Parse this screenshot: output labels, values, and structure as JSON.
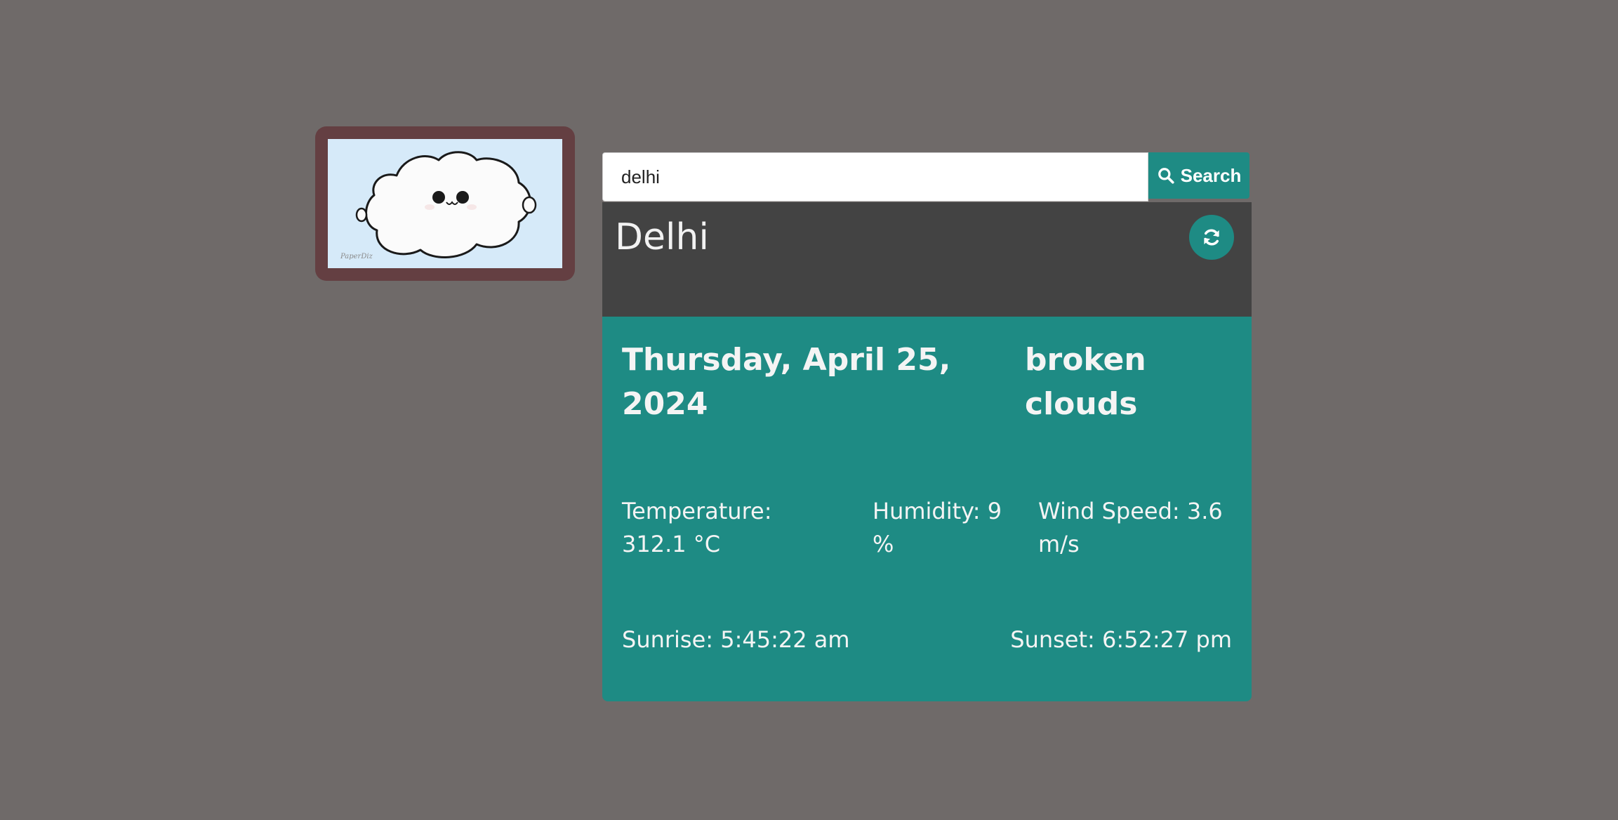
{
  "search": {
    "value": "delhi",
    "button_label": "Search"
  },
  "weather": {
    "city": "Delhi",
    "date": "Thursday, April 25, 2024",
    "description": "broken clouds",
    "temperature": {
      "label": "Temperature:",
      "value": "312.1 °C"
    },
    "humidity": {
      "label": "Humidity:",
      "value": "9 %"
    },
    "wind_speed": {
      "label": "Wind Speed:",
      "value": "3.6 m/s"
    },
    "sunrise": {
      "label": "Sunrise:",
      "value": "5:45:22 am"
    },
    "sunset": {
      "label": "Sunset:",
      "value": "6:52:27 pm"
    }
  },
  "illustration": {
    "signature": "PaperDiz"
  },
  "colors": {
    "page_background": "#6f6a69",
    "accent": "#1e8b84",
    "header_background": "#434343",
    "frame": "#643f42",
    "illustration_sky": "#d6eaf9"
  },
  "icons": {
    "search": "search-icon",
    "refresh": "refresh-icon",
    "cloud": "cloud-illustration"
  }
}
